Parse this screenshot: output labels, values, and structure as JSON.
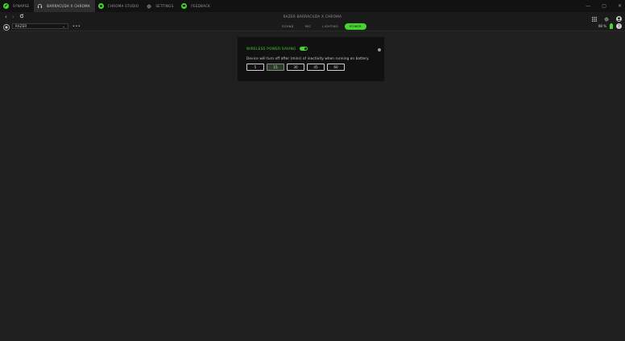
{
  "tabs": [
    {
      "label": "SYNAPSE",
      "icon": "razer-logo-icon",
      "active": false
    },
    {
      "label": "BARRACUDA X CHROMA",
      "icon": "headset-icon",
      "active": true
    },
    {
      "label": "CHROMA STUDIO",
      "icon": "chroma-icon",
      "active": false
    },
    {
      "label": "SETTINGS",
      "icon": "gear-icon",
      "active": false
    },
    {
      "label": "FEEDBACK",
      "icon": "feedback-icon",
      "active": false
    }
  ],
  "page_title": "RAZER BARRACUDA X CHROMA",
  "device_select": {
    "value": "RAZER"
  },
  "main_tabs": [
    {
      "label": "SOUND",
      "active": false
    },
    {
      "label": "MIC",
      "active": false
    },
    {
      "label": "LIGHTING",
      "active": false
    },
    {
      "label": "POWER",
      "active": true
    }
  ],
  "battery": {
    "percent_label": "98 %",
    "level": 0.98
  },
  "power_panel": {
    "heading": "WIRELESS POWER SAVING",
    "toggle_on": true,
    "description": "Device will turn off after (mins) of inactivity when running on battery.",
    "options": [
      {
        "label": "5",
        "selected": false
      },
      {
        "label": "15",
        "selected": true
      },
      {
        "label": "30",
        "selected": false
      },
      {
        "label": "45",
        "selected": false
      },
      {
        "label": "60",
        "selected": false
      }
    ]
  },
  "colors": {
    "accent": "#44d62c",
    "background": "#1f1f1f",
    "panel": "#111111"
  }
}
